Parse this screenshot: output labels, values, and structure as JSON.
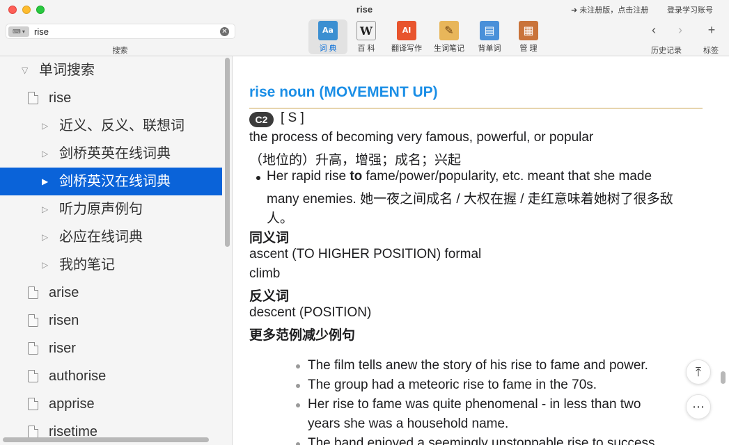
{
  "window": {
    "title": "rise",
    "register_link": "➜ 未注册版，点击注册",
    "login_link": "登录学习账号"
  },
  "search": {
    "value": "rise",
    "placeholder": "",
    "caption": "搜索",
    "keyboard_icon": "keyboard-icon",
    "clear_icon": "clear-icon"
  },
  "toolbar": {
    "tools": [
      {
        "label": "词 典",
        "icon": "dictionary-icon",
        "glyph": "Aa",
        "color": "#3b8fd1",
        "active": true
      },
      {
        "label": "百 科",
        "icon": "wiki-icon",
        "glyph": "W",
        "color": "#f2f2f2",
        "active": false
      },
      {
        "label": "翻译写作",
        "icon": "translate-icon",
        "glyph": "AI",
        "color": "#e8542d",
        "active": false
      },
      {
        "label": "生词笔记",
        "icon": "notebook-icon",
        "glyph": "✎",
        "color": "#e8b65a",
        "active": false
      },
      {
        "label": "背单词",
        "icon": "flashcard-icon",
        "glyph": "▤",
        "color": "#4a90d9",
        "active": false
      },
      {
        "label": "管 理",
        "icon": "manage-icon",
        "glyph": "▦",
        "color": "#c9733a",
        "active": false
      }
    ],
    "history_label": "历史记录",
    "bookmark_label": "标签",
    "back_glyph": "‹",
    "forward_glyph": "›",
    "add_glyph": "+"
  },
  "sidebar": {
    "items": [
      {
        "label": "单词搜索",
        "kind": "group",
        "expanded": true
      },
      {
        "label": "rise",
        "kind": "doc"
      },
      {
        "label": "近义、反义、联想词",
        "kind": "sub"
      },
      {
        "label": "剑桥英英在线词典",
        "kind": "sub"
      },
      {
        "label": "剑桥英汉在线词典",
        "kind": "sub",
        "selected": true
      },
      {
        "label": "听力原声例句",
        "kind": "sub"
      },
      {
        "label": "必应在线词典",
        "kind": "sub"
      },
      {
        "label": "我的笔记",
        "kind": "sub"
      },
      {
        "label": "arise",
        "kind": "doc"
      },
      {
        "label": "risen",
        "kind": "doc"
      },
      {
        "label": "riser",
        "kind": "doc"
      },
      {
        "label": "authorise",
        "kind": "doc"
      },
      {
        "label": "apprise",
        "kind": "doc"
      },
      {
        "label": "risetime",
        "kind": "doc"
      }
    ]
  },
  "entry": {
    "title": "rise noun (MOVEMENT UP)",
    "level": "C2",
    "grammar": "[ S ]",
    "definition_en": "the process of becoming very famous, powerful, or popular",
    "definition_zh": "（地位的）升高，增强；成名；兴起",
    "example": {
      "pre": "Her rapid rise ",
      "bold": "to",
      "post": " fame/power/popularity, etc. meant that she made",
      "line2": "many enemies. 她一夜之间成名 / 大权在握 / 走红意味着她树了很多敌",
      "line3": "人。"
    },
    "synonyms_heading": "同义词",
    "synonyms": [
      "ascent (TO HIGHER POSITION) formal",
      "climb"
    ],
    "antonyms_heading": "反义词",
    "antonyms": [
      "descent (POSITION)"
    ],
    "more_heading": "更多范例减少例句",
    "more_examples": [
      "The film tells anew the story of his rise to fame and power.",
      "The group had a meteoric rise to fame in the 70s.",
      "Her rise to fame was quite phenomenal - in less than two",
      "years she was a household name.",
      "The band enjoyed a seemingly unstoppable rise to success."
    ],
    "back_to_top_icon": "back-to-top-icon",
    "more_icon": "more-options-icon"
  }
}
